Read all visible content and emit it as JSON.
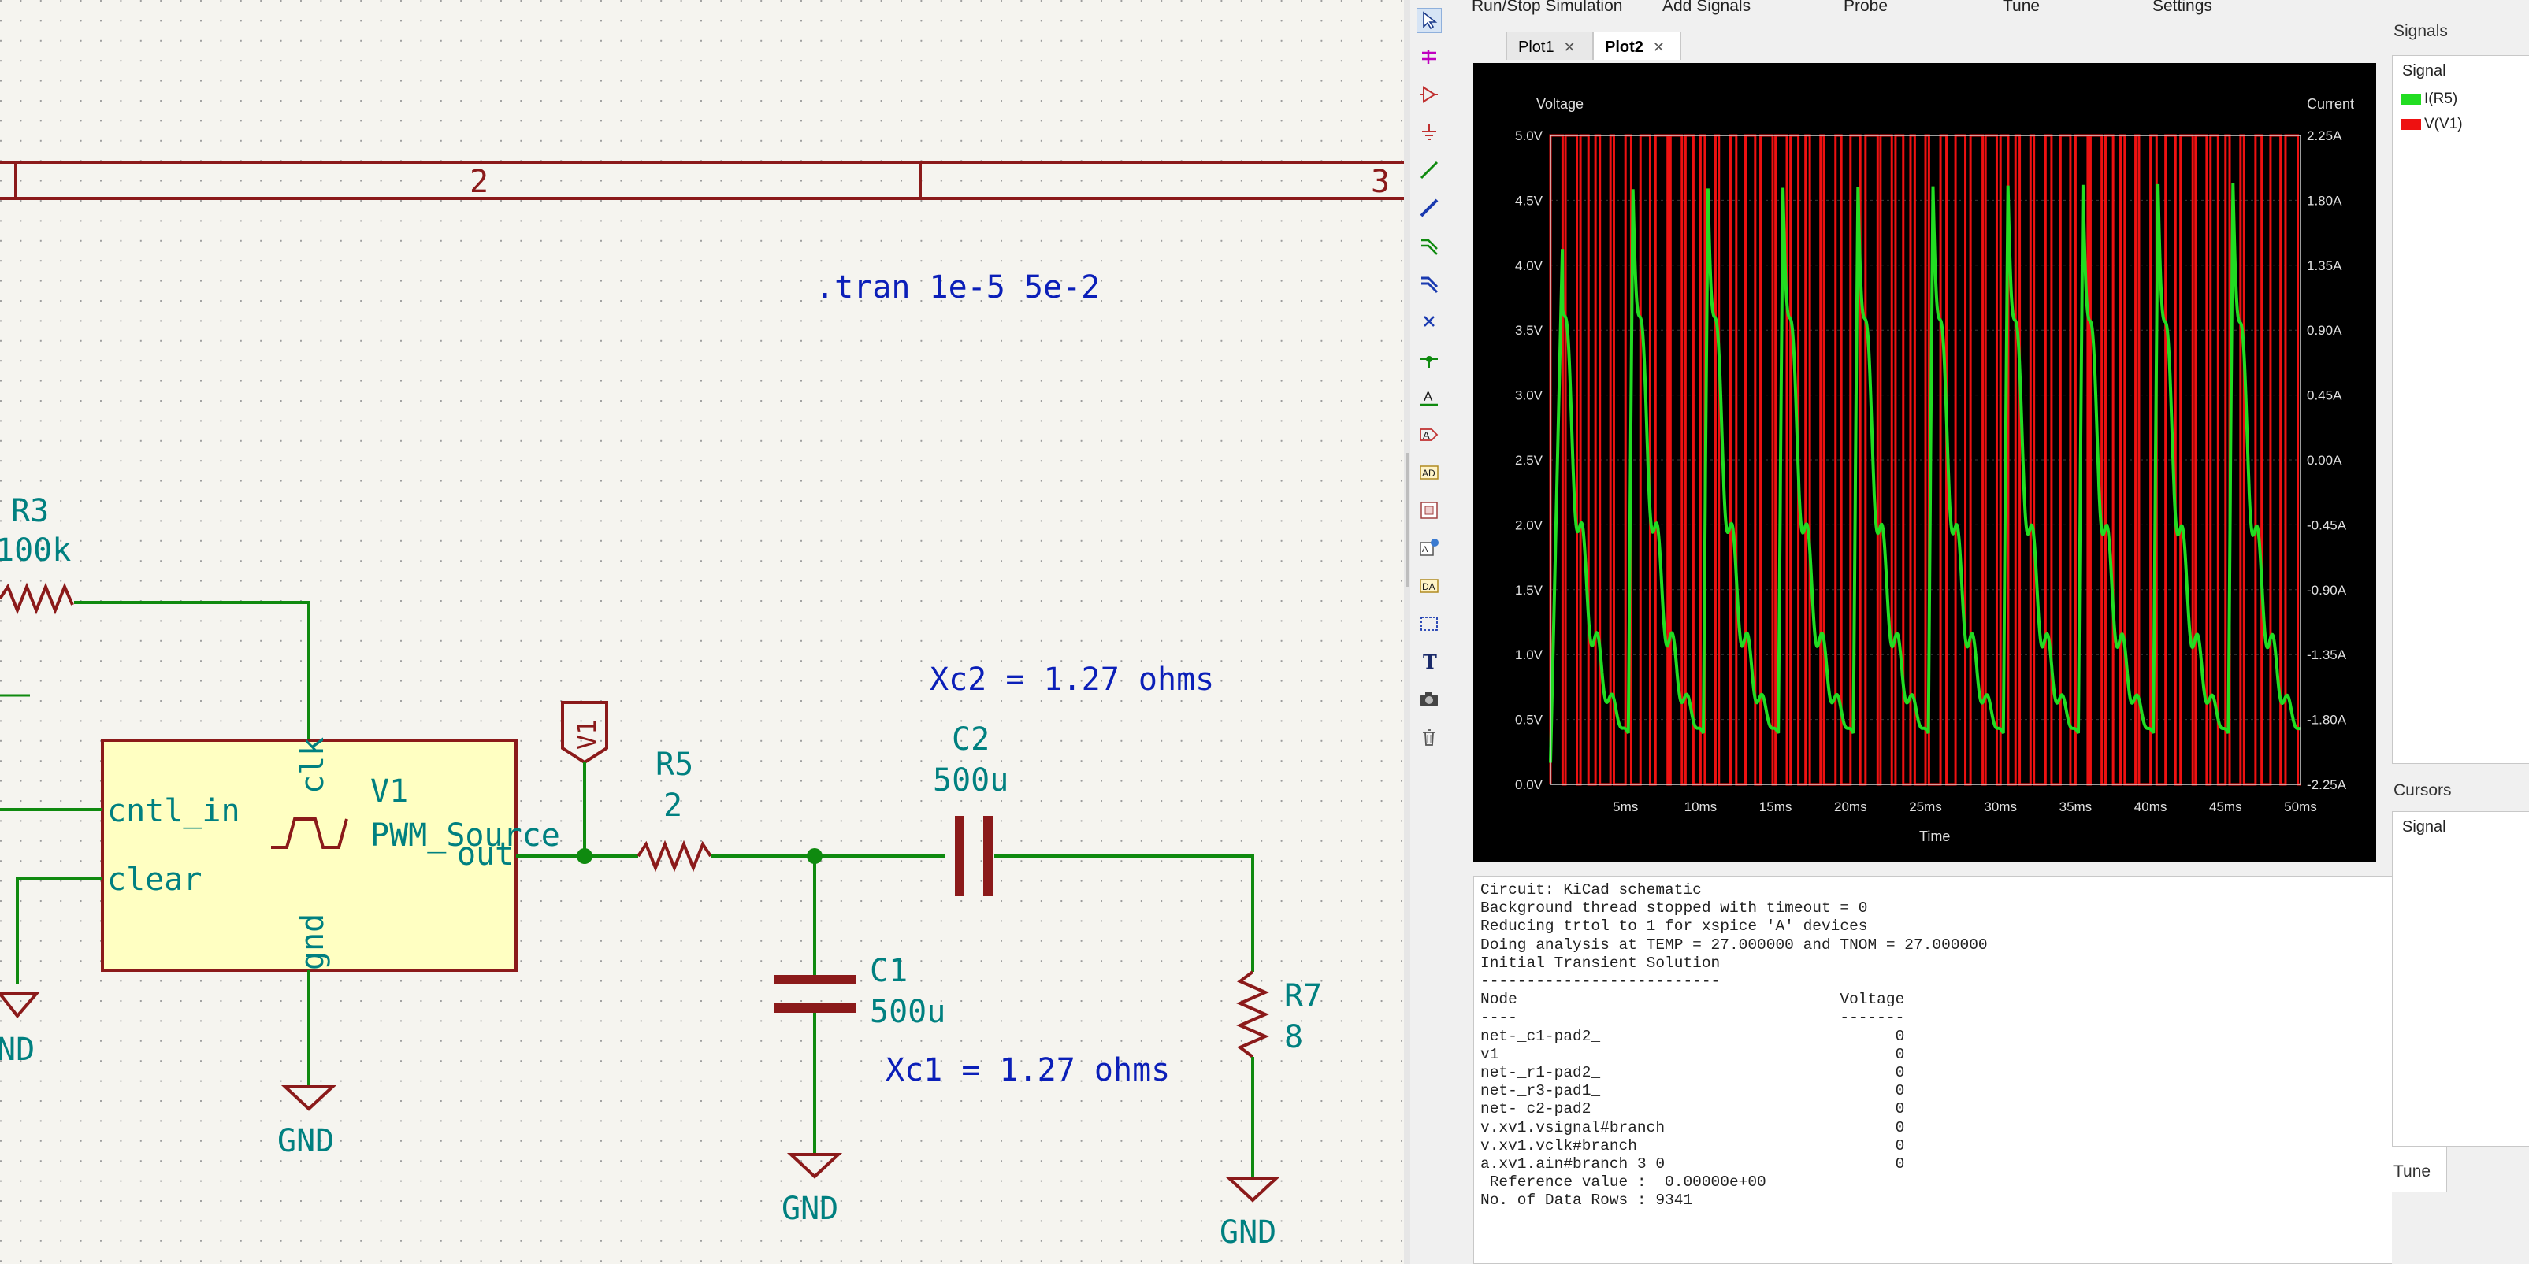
{
  "schematic": {
    "sheet_columns": [
      "2",
      "3"
    ],
    "tran_directive": ".tran 1e-5 5e-2",
    "r3": {
      "ref": "R3",
      "value": "100k"
    },
    "v1": {
      "ref": "V1",
      "value": "PWM_Source",
      "pins": {
        "cntl_in": "cntl_in",
        "clear": "clear",
        "clk": "clk",
        "gnd": "gnd",
        "out": "out"
      }
    },
    "v1_label": "V1",
    "r5": {
      "ref": "R5",
      "value": "2"
    },
    "c2": {
      "ref": "C2",
      "value": "500u"
    },
    "c1": {
      "ref": "C1",
      "value": "500u"
    },
    "r7": {
      "ref": "R7",
      "value": "8"
    },
    "xc2_note": "Xc2 = 1.27 ohms",
    "xc1_note": "Xc1 =  1.27 ohms",
    "gnd_labels": [
      "ND",
      "GND",
      "GND",
      "GND"
    ],
    "colors": {
      "wire": "#0f8a0f",
      "component": "#8b1a1a",
      "ref_text": "#008080",
      "note_text": "#0b1fb8",
      "symbol_fill": "#ffffc2"
    }
  },
  "simulator": {
    "menu": [
      "Run/Stop Simulation",
      "Add Signals",
      "Probe",
      "Tune",
      "Settings"
    ],
    "toolbar_icons": [
      "pointer-icon",
      "bus-entry-icon",
      "add-symbol-icon",
      "power-port-icon",
      "wire-icon",
      "bus-icon",
      "wire-to-bus-entry-icon",
      "bus-to-bus-entry-icon",
      "no-connect-icon",
      "junction-icon",
      "net-label-icon",
      "global-label-icon",
      "hierarchical-label-icon",
      "hierarchical-sheet-icon",
      "import-sheet-pin-icon",
      "sheet-pin-icon",
      "line-icon",
      "text-icon",
      "image-icon",
      "delete-icon"
    ],
    "tabs": [
      {
        "label": "Plot1",
        "close": "✕",
        "active": false
      },
      {
        "label": "Plot2",
        "close": "✕",
        "active": true
      }
    ],
    "signals_heading": "Signals",
    "signals_header": "Signal",
    "signals": [
      {
        "name": "I(R5)",
        "color": "#22dd22"
      },
      {
        "name": "V(V1)",
        "color": "#ee1111"
      }
    ],
    "cursors_heading": "Cursors",
    "cursors_header": "Signal",
    "tune_heading": "Tune",
    "console_lines": [
      "Circuit: KiCad schematic",
      "Background thread stopped with timeout = 0",
      "Reducing trtol to 1 for xspice 'A' devices",
      "Doing analysis at TEMP = 27.000000 and TNOM = 27.000000",
      "Initial Transient Solution",
      "--------------------------",
      "Node                                   Voltage",
      "----                                   -------",
      "net-_c1-pad2_                                0",
      "v1                                           0",
      "net-_r1-pad2_                                0",
      "net-_r3-pad1_                                0",
      "net-_c2-pad2_                                0",
      "v.xv1.vsignal#branch                         0",
      "v.xv1.vclk#branch                            0",
      "a.xv1.ain#branch_3_0                         0",
      " Reference value :  0.00000e+00",
      "No. of Data Rows : 9341"
    ]
  },
  "chart_data": {
    "type": "line",
    "title": "",
    "xlabel": "Time",
    "ylabel_left": "Voltage",
    "ylabel_right": "Current",
    "x_ticks": [
      "5ms",
      "10ms",
      "15ms",
      "20ms",
      "25ms",
      "30ms",
      "35ms",
      "40ms",
      "45ms",
      "50ms"
    ],
    "y_left_ticks": [
      "0.0V",
      "0.5V",
      "1.0V",
      "1.5V",
      "2.0V",
      "2.5V",
      "3.0V",
      "3.5V",
      "4.0V",
      "4.5V",
      "5.0V"
    ],
    "y_right_ticks": [
      "-2.25A",
      "-1.80A",
      "-1.35A",
      "-0.90A",
      "-0.45A",
      "0.00A",
      "0.45A",
      "0.90A",
      "1.35A",
      "1.80A",
      "2.25A"
    ],
    "xlim": [
      0,
      50
    ],
    "ylim_left": [
      0,
      5
    ],
    "ylim_right": [
      -2.25,
      2.25
    ],
    "grid": true,
    "background": "#000000",
    "series": [
      {
        "name": "V(V1)",
        "color": "#ee1111",
        "axis": "left",
        "kind": "pwm",
        "low": 0,
        "high": 5,
        "period_ms": 1.0
      },
      {
        "name": "I(R5)",
        "color": "#22dd22",
        "axis": "right",
        "kind": "rc-response",
        "peak_first": 1.5,
        "peak": 2.0,
        "min": -2.1,
        "envelope_period_ms": 5.0
      }
    ]
  }
}
